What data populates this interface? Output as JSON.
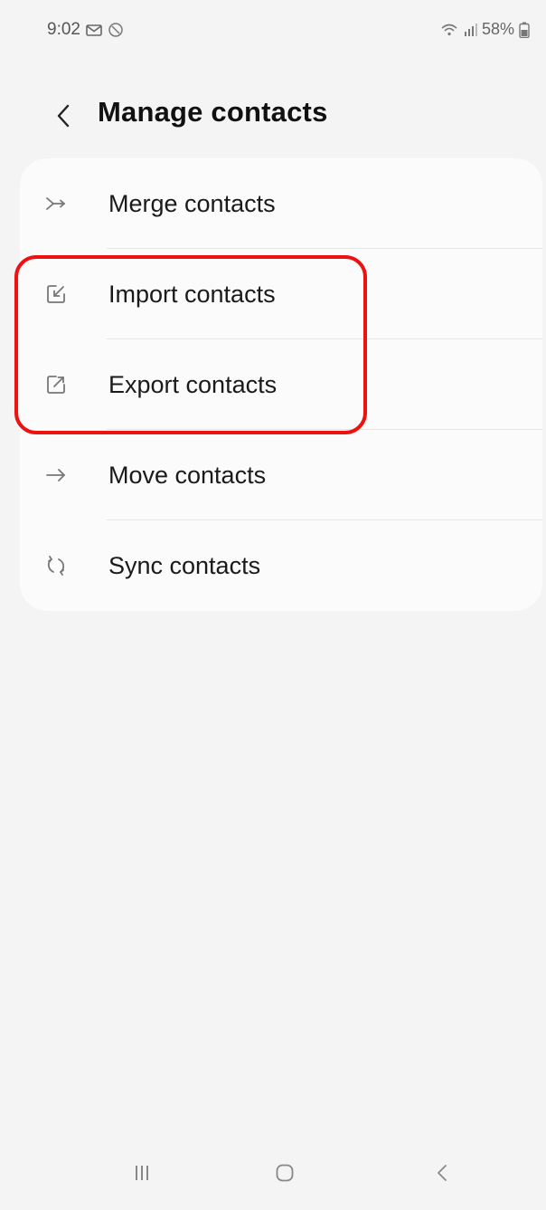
{
  "status_bar": {
    "time": "9:02",
    "battery": "58%",
    "icons_left": [
      "mail-icon",
      "blocked-circle-icon"
    ],
    "icons_right": [
      "wifi-icon",
      "signal-icon",
      "battery-icon"
    ]
  },
  "header": {
    "title": "Manage contacts",
    "back_icon": "chevron-left-icon"
  },
  "menu": {
    "items": [
      {
        "label": "Merge contacts",
        "icon": "merge-icon"
      },
      {
        "label": "Import contacts",
        "icon": "import-icon"
      },
      {
        "label": "Export contacts",
        "icon": "export-icon"
      },
      {
        "label": "Move contacts",
        "icon": "arrow-right-icon"
      },
      {
        "label": "Sync contacts",
        "icon": "sync-icon"
      }
    ]
  },
  "annotation": {
    "highlight_color": "#ee1111",
    "highlighted_items": [
      "Import contacts",
      "Export contacts"
    ]
  },
  "nav_bar": {
    "buttons": [
      "recent-apps-icon",
      "home-icon",
      "back-icon"
    ]
  },
  "colors": {
    "background": "#f4f4f4",
    "card": "#fbfbfb",
    "text": "#1a1a1a",
    "icon": "#777777"
  }
}
